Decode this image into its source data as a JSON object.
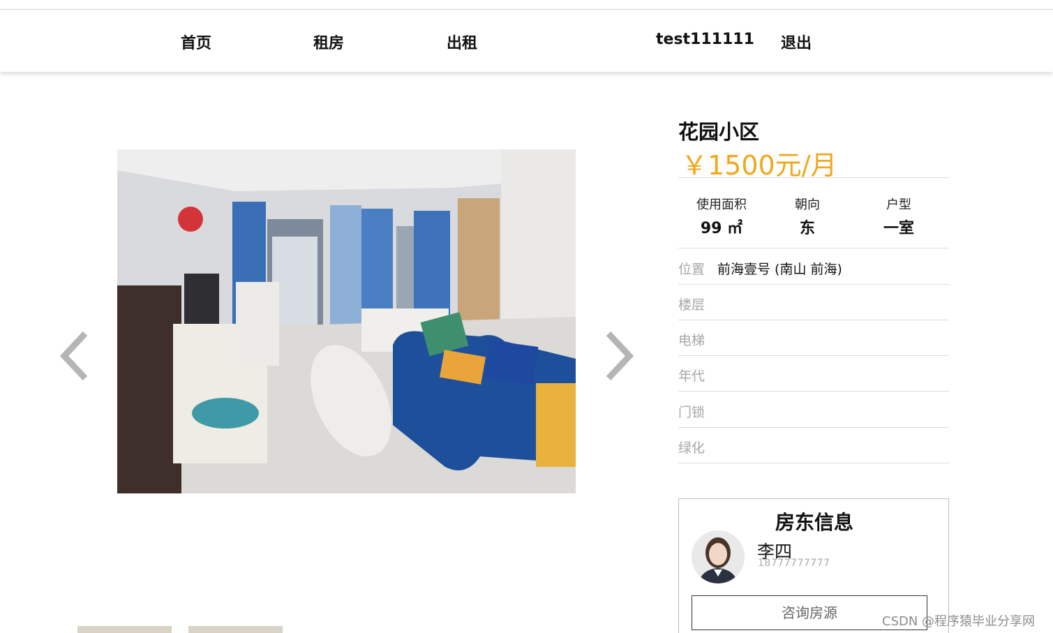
{
  "nav": {
    "home": "首页",
    "rent": "租房",
    "let": "出租",
    "username": "test111111",
    "logout": "退出"
  },
  "listing": {
    "title": "花园小区",
    "price": "￥1500元/月",
    "stats": [
      {
        "label": "使用面积",
        "value": "99 ㎡"
      },
      {
        "label": "朝向",
        "value": "东"
      },
      {
        "label": "户型",
        "value": "一室"
      }
    ],
    "rows": [
      {
        "label": "位置",
        "value": "前海壹号 (南山 前海)"
      },
      {
        "label": "楼层",
        "value": ""
      },
      {
        "label": "电梯",
        "value": ""
      },
      {
        "label": "年代",
        "value": ""
      },
      {
        "label": "门锁",
        "value": ""
      },
      {
        "label": "绿化",
        "value": ""
      }
    ]
  },
  "landlord": {
    "heading": "房东信息",
    "name": "李四",
    "phone": "18777777777",
    "consult_label": "咨询房源"
  },
  "icons": {
    "prev": "chevron-left-icon",
    "next": "chevron-right-icon"
  },
  "colors": {
    "price": "#f0a81c",
    "sofa": "#1e4f9a"
  },
  "watermark": "CSDN @程序猿毕业分享网"
}
